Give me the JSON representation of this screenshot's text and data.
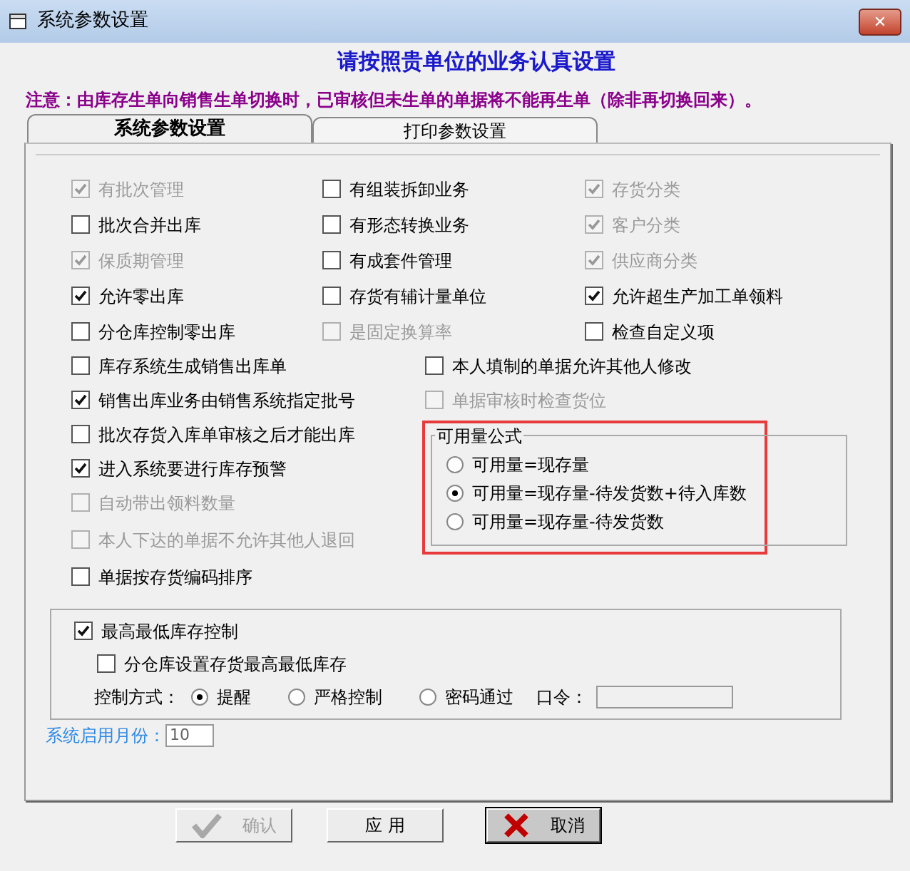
{
  "window": {
    "title": "系统参数设置",
    "close": "✕"
  },
  "heading": "请按照贵单位的业务认真设置",
  "notice": "注意：由库存生单向销售生单切换时，已审核但未生单的单据将不能再生单（除非再切换回来）。",
  "tabs": [
    {
      "label": "系统参数设置",
      "selected": true
    },
    {
      "label": "打印参数设置",
      "selected": false
    }
  ],
  "grid_options": [
    {
      "label": "有批次管理",
      "checked": true,
      "disabled": true
    },
    {
      "label": "有组装拆卸业务",
      "checked": false,
      "disabled": false
    },
    {
      "label": "存货分类",
      "checked": true,
      "disabled": true
    },
    {
      "label": "批次合并出库",
      "checked": false,
      "disabled": false
    },
    {
      "label": "有形态转换业务",
      "checked": false,
      "disabled": false
    },
    {
      "label": "客户分类",
      "checked": true,
      "disabled": true
    },
    {
      "label": "保质期管理",
      "checked": true,
      "disabled": true
    },
    {
      "label": "有成套件管理",
      "checked": false,
      "disabled": false
    },
    {
      "label": "供应商分类",
      "checked": true,
      "disabled": true
    },
    {
      "label": "允许零出库",
      "checked": true,
      "disabled": false
    },
    {
      "label": "存货有辅计量单位",
      "checked": false,
      "disabled": false
    },
    {
      "label": "允许超生产加工单领料",
      "checked": true,
      "disabled": false
    },
    {
      "label": "分仓库控制零出库",
      "checked": false,
      "disabled": false
    },
    {
      "label": "是固定换算率",
      "checked": false,
      "disabled": true
    },
    {
      "label": "检查自定义项",
      "checked": false,
      "disabled": false
    }
  ],
  "left_options": [
    {
      "label": "库存系统生成销售出库单",
      "checked": false,
      "disabled": false
    },
    {
      "label": "销售出库业务由销售系统指定批号",
      "checked": true,
      "disabled": false
    },
    {
      "label": "批次存货入库单审核之后才能出库",
      "checked": false,
      "disabled": false
    },
    {
      "label": "进入系统要进行库存预警",
      "checked": true,
      "disabled": false
    },
    {
      "label": "自动带出领料数量",
      "checked": false,
      "disabled": true
    },
    {
      "label": "本人下达的单据不允许其他人退回",
      "checked": false,
      "disabled": true
    },
    {
      "label": "单据按存货编码排序",
      "checked": false,
      "disabled": false
    }
  ],
  "right_options": [
    {
      "label": "本人填制的单据允许其他人修改",
      "checked": false,
      "disabled": false
    },
    {
      "label": "单据审核时检查货位",
      "checked": false,
      "disabled": true
    }
  ],
  "formula_group": {
    "title": "可用量公式",
    "options": [
      {
        "label": "可用量=现存量",
        "selected": false
      },
      {
        "label": "可用量=现存量-待发货数+待入库数",
        "selected": true
      },
      {
        "label": "可用量=现存量-待发货数",
        "selected": false
      }
    ]
  },
  "stock_control": {
    "main": {
      "label": "最高最低库存控制",
      "checked": true
    },
    "sub": {
      "label": "分仓库设置存货最高最低库存",
      "checked": false
    },
    "method_label": "控制方式：",
    "methods": [
      {
        "label": "提醒",
        "selected": true
      },
      {
        "label": "严格控制",
        "selected": false
      },
      {
        "label": "密码通过",
        "selected": false
      }
    ],
    "password_label": "口令："
  },
  "start_month": {
    "label": "系统启用月份：",
    "value": "10"
  },
  "buttons": [
    {
      "kind": "confirm",
      "label": "确认",
      "disabled": true
    },
    {
      "kind": "apply",
      "label": "应 用",
      "disabled": false
    },
    {
      "kind": "cancel",
      "label": "取消",
      "disabled": false
    }
  ]
}
